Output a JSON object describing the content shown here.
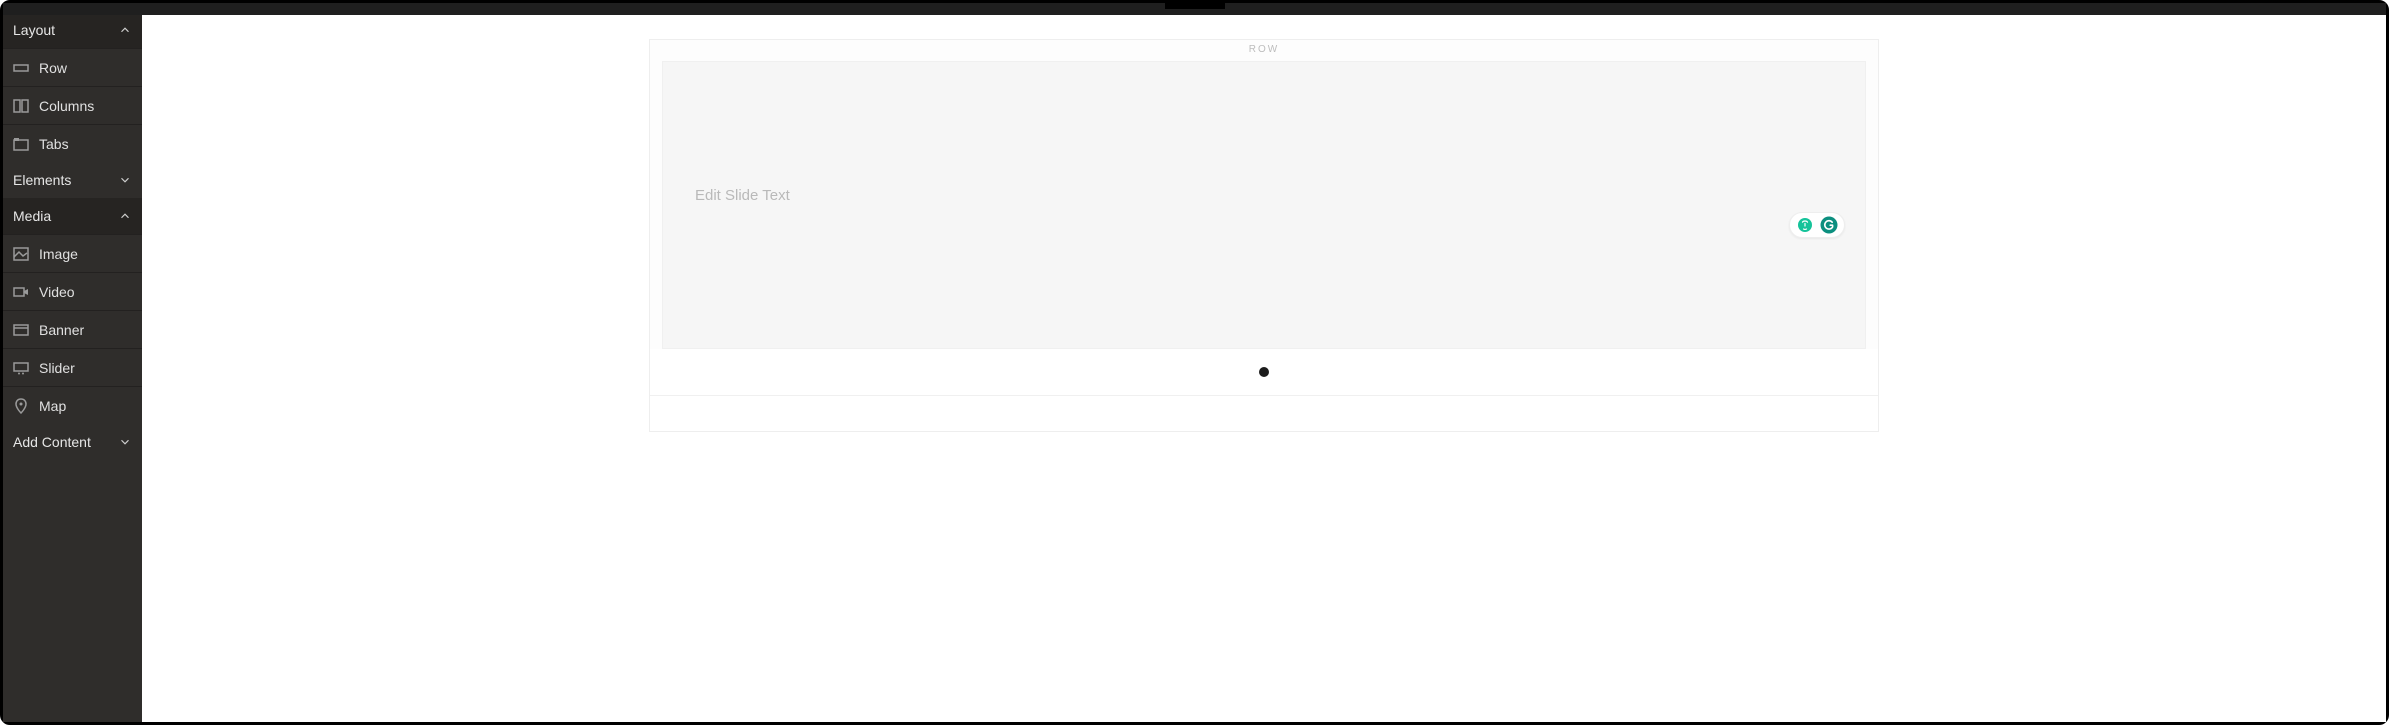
{
  "sidebar": {
    "sections": [
      {
        "id": "layout",
        "label": "Layout",
        "expanded": true,
        "items": [
          {
            "id": "row",
            "label": "Row",
            "icon": "row-icon"
          },
          {
            "id": "columns",
            "label": "Columns",
            "icon": "columns-icon"
          },
          {
            "id": "tabs",
            "label": "Tabs",
            "icon": "tabs-icon"
          }
        ]
      },
      {
        "id": "elements",
        "label": "Elements",
        "expanded": false,
        "items": []
      },
      {
        "id": "media",
        "label": "Media",
        "expanded": true,
        "items": [
          {
            "id": "image",
            "label": "Image",
            "icon": "image-icon"
          },
          {
            "id": "video",
            "label": "Video",
            "icon": "video-icon"
          },
          {
            "id": "banner",
            "label": "Banner",
            "icon": "banner-icon"
          },
          {
            "id": "slider",
            "label": "Slider",
            "icon": "slider-icon"
          },
          {
            "id": "map",
            "label": "Map",
            "icon": "map-icon"
          }
        ]
      },
      {
        "id": "add_content",
        "label": "Add Content",
        "expanded": false,
        "items": []
      }
    ]
  },
  "canvas": {
    "row_label": "ROW",
    "slide_placeholder": "Edit Slide Text"
  },
  "colors": {
    "sidebar_bg": "#2f2d2b",
    "accent_teal": "#0c8f7f"
  }
}
